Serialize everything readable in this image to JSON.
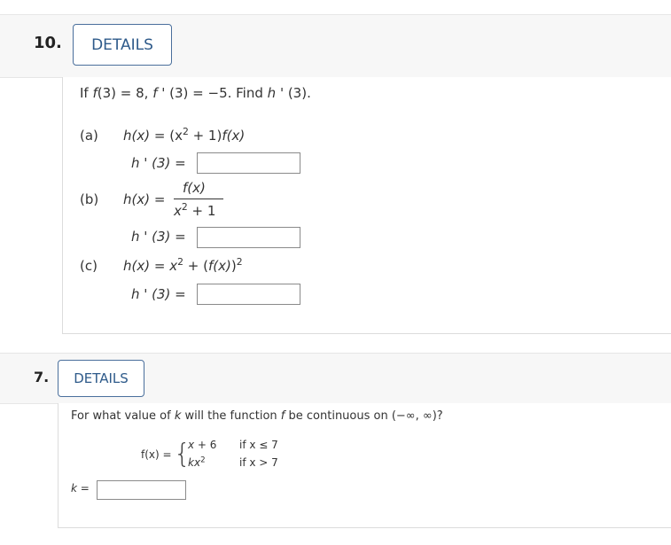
{
  "q10": {
    "number": "10.",
    "details_label": "DETAILS",
    "prompt": {
      "f": "f",
      "a1": "(3) = 8, ",
      "fp": "f",
      "a2": " ' (3) = −5. Find ",
      "h": "h",
      "a3": " ' (3).",
      "if": "If "
    },
    "parts": [
      {
        "label": "(a)",
        "func_lhs": "h(x) =",
        "func_rhs_1": "(x",
        "sup": "2",
        "func_rhs_2": " + 1)",
        "func_rhs_f": "f(x)",
        "answer_label": "h ' (3) =",
        "answer_value": ""
      },
      {
        "label": "(b)",
        "func_lhs": "h(x) =",
        "numerator": "f(x)",
        "den_x": "x",
        "den_sup": "2",
        "den_rest": " + 1",
        "answer_label": "h ' (3) =",
        "answer_value": ""
      },
      {
        "label": "(c)",
        "func_lhs": "h(x) =",
        "rhs_x": "x",
        "rhs_sup": "2",
        "rhs_plus": " + (",
        "rhs_f": "f(x)",
        "rhs_close": ")",
        "rhs_sup2": "2",
        "answer_label": "h ' (3) =",
        "answer_value": ""
      }
    ]
  },
  "q7": {
    "number": "7.",
    "details_label": "DETAILS",
    "prompt_pre": "For what value of ",
    "prompt_k": "k",
    "prompt_mid": " will the function ",
    "prompt_f": "f",
    "prompt_post": " be continuous on (−∞, ∞)?",
    "fx_label": "f(x) =",
    "cases": [
      {
        "expr_pre": "x",
        "expr_post": " + 6",
        "cond": "if x ≤ 7"
      },
      {
        "expr_pre": "kx",
        "expr_sup": "2",
        "cond": "if x > 7"
      }
    ],
    "answer_label": "k =",
    "answer_value": ""
  }
}
